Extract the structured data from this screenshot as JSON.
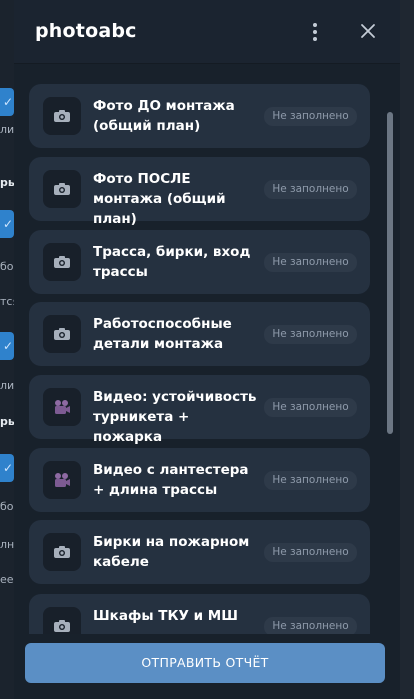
{
  "background": {
    "fragments": [
      {
        "text": "ли",
        "bold": false
      },
      {
        "text": "ры",
        "bold": true
      },
      {
        "text": "бо",
        "bold": false
      },
      {
        "text": "тся",
        "bold": false
      },
      {
        "text": "ли",
        "bold": false
      },
      {
        "text": "ры",
        "bold": true
      },
      {
        "text": "бо",
        "bold": false
      },
      {
        "text": "лн",
        "bold": false
      },
      {
        "text": "ее",
        "bold": false
      }
    ]
  },
  "header": {
    "title": "photoabc",
    "menu_icon": "more-vertical-icon",
    "close_icon": "close-icon"
  },
  "items": [
    {
      "label": "Фото ДО монтажа (общий план)",
      "status": "Не заполнено",
      "icon": "camera-icon"
    },
    {
      "label": "Фото ПОСЛЕ монтажа (общий план)",
      "status": "Не заполнено",
      "icon": "camera-icon"
    },
    {
      "label": "Трасса, бирки, вход трассы",
      "status": "Не заполнено",
      "icon": "camera-icon"
    },
    {
      "label": "Работоспособные детали монтажа",
      "status": "Не заполнено",
      "icon": "camera-icon"
    },
    {
      "label": "Видео: устойчивость турникета + пожарка",
      "status": "Не заполнено",
      "icon": "video-camera-icon"
    },
    {
      "label": "Видео с лантестера + длина трассы",
      "status": "Не заполнено",
      "icon": "video-camera-icon"
    },
    {
      "label": "Бирки на пожарном кабеле",
      "status": "Не заполнено",
      "icon": "camera-icon"
    },
    {
      "label": "Шкафы ТКУ и МШ",
      "status": "Не заполнено",
      "icon": "camera-icon"
    }
  ],
  "footer": {
    "submit_label": "ОТПРАВИТЬ ОТЧЁТ"
  },
  "colors": {
    "accent": "#5b8fc5",
    "card": "#253140",
    "badge": "#2e3a49"
  }
}
